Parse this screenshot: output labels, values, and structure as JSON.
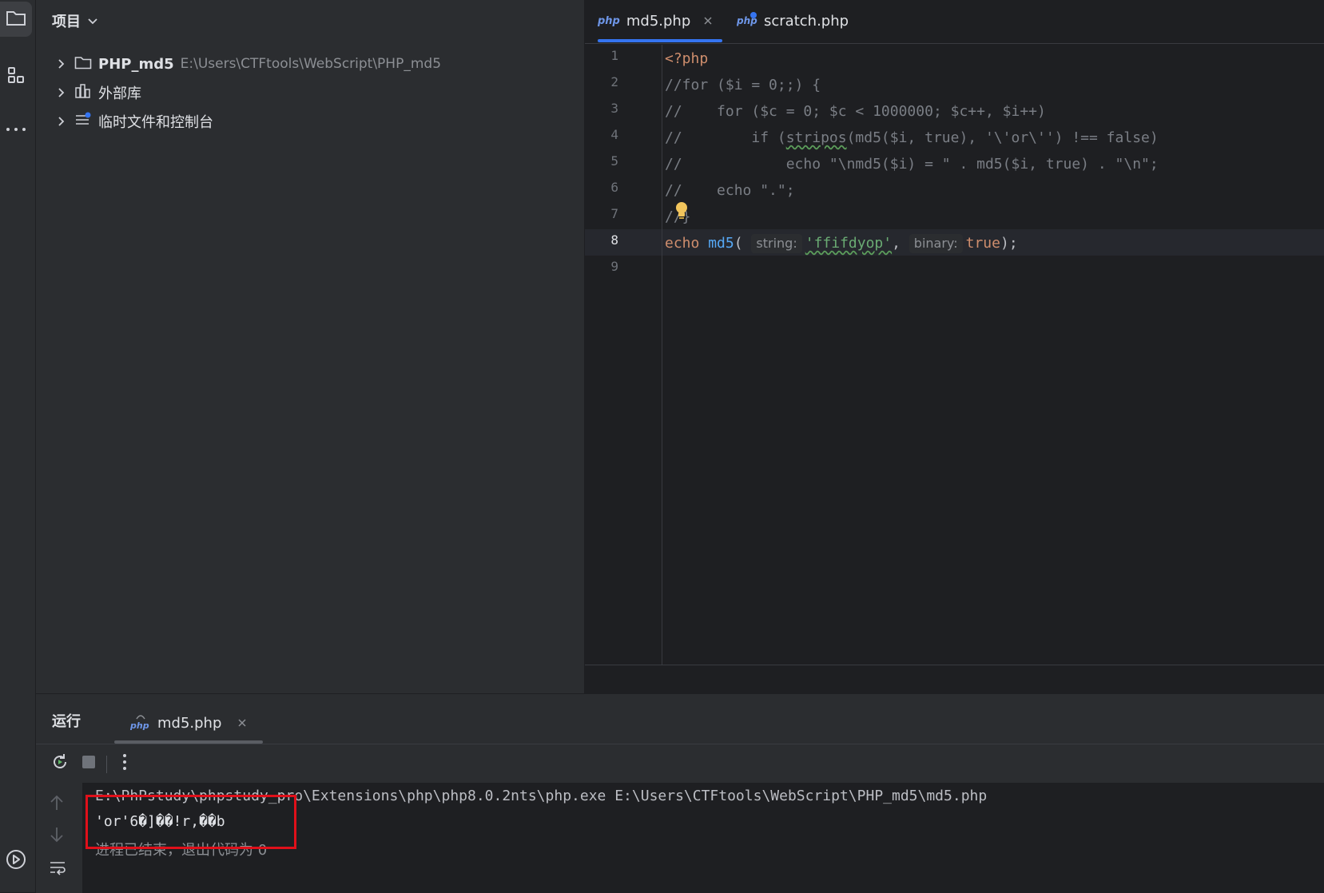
{
  "project": {
    "title": "项目",
    "items": [
      {
        "label": "PHP_md5",
        "path": "E:\\Users\\CTFtools\\WebScript\\PHP_md5"
      },
      {
        "label": "外部库"
      },
      {
        "label": "临时文件和控制台"
      }
    ]
  },
  "editor": {
    "tabs": [
      {
        "badge": "php",
        "label": "md5.php",
        "active": true
      },
      {
        "label": "scratch.php",
        "active": false
      }
    ],
    "line_numbers": [
      "1",
      "2",
      "3",
      "4",
      "5",
      "6",
      "7",
      "8",
      "9"
    ],
    "current_line": 8,
    "code": {
      "l1": "<?php",
      "l2": "//for ($i = 0;;) {",
      "l3": "//    for ($c = 0; $c < 1000000; $c++, $i++)",
      "l4_pre": "//        if (",
      "l4_fn": "stripos",
      "l4_post": "(md5($i, true), '\\'or\\'') !== false)",
      "l5": "//            echo \"\\nmd5($i) = \" . md5($i, true) . \"\\n\";",
      "l6": "//    echo \".\";",
      "l7": "//}",
      "l8_echo": "echo",
      "l8_fn": "md5",
      "l8_paren": "(",
      "l8_hint1": "string:",
      "l8_str": "'ffifdyop'",
      "l8_comma": ",",
      "l8_hint2": "binary:",
      "l8_true": "true",
      "l8_end": ");"
    }
  },
  "run": {
    "title": "运行",
    "tab_label": "md5.php",
    "console": {
      "command": "E:\\PhPstudy\\phpstudy_pro\\Extensions\\php\\php8.0.2nts\\php.exe E:\\Users\\CTFtools\\WebScript\\PHP_md5\\md5.php",
      "output": "'or'6�]��!r,��b",
      "exit": "进程已结束，退出代码为 0"
    }
  },
  "colors": {
    "accent": "#3574f0",
    "annotation": "#e0101a"
  }
}
